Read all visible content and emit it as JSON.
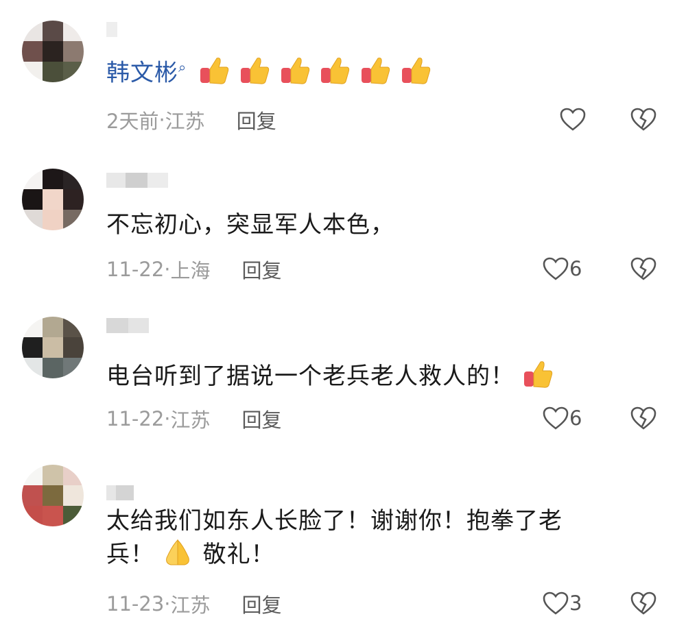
{
  "comments": [
    {
      "mention": "韩文彬",
      "text": "",
      "text_line2": "",
      "emojis_after_mention": 6,
      "time": "2天前",
      "location": "江苏",
      "reply_label": "回复",
      "likes": ""
    },
    {
      "mention": "",
      "text": "不忘初心，突显军人本色，",
      "text_line2": "",
      "time": "11-22",
      "location": "上海",
      "reply_label": "回复",
      "likes": "6"
    },
    {
      "mention": "",
      "text": "电台听到了据说一个老兵老人救人的！",
      "text_line2": "",
      "time": "11-22",
      "location": "江苏",
      "reply_label": "回复",
      "likes": "6"
    },
    {
      "mention": "",
      "text": "太给我们如东人长脸了！谢谢你！抱拳了老",
      "text_line2_a": "兵！",
      "text_line2_b": "敬礼！",
      "time": "11-23",
      "location": "江苏",
      "reply_label": "回复",
      "likes": "3"
    }
  ],
  "separator": "·",
  "icons": {
    "like": "heart-outline-icon",
    "dislike": "broken-heart-icon",
    "thumbs": "thumbs-up-emoji",
    "salute": "pressed-hands-emoji",
    "mention_search": "search-icon"
  },
  "colors": {
    "mention": "#2b5aa8",
    "meta": "#9b9b9b",
    "reply": "#5a5a5a",
    "emoji_yellow": "#f9c235",
    "emoji_red": "#e8505b"
  }
}
